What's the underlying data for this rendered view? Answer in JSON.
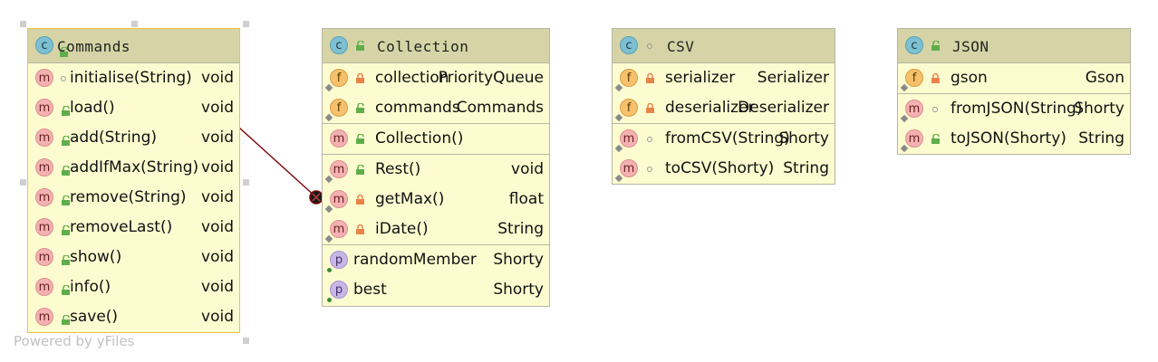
{
  "classes": {
    "commands": {
      "name": "Commands",
      "methods": [
        {
          "name": "initialise(String)",
          "type": "void",
          "visibility": "package"
        },
        {
          "name": "load()",
          "type": "void",
          "visibility": "public"
        },
        {
          "name": "add(String)",
          "type": "void",
          "visibility": "public"
        },
        {
          "name": "addIfMax(String)",
          "type": "void",
          "visibility": "public"
        },
        {
          "name": "remove(String)",
          "type": "void",
          "visibility": "public"
        },
        {
          "name": "removeLast()",
          "type": "void",
          "visibility": "public"
        },
        {
          "name": "show()",
          "type": "void",
          "visibility": "public"
        },
        {
          "name": "info()",
          "type": "void",
          "visibility": "public"
        },
        {
          "name": "save()",
          "type": "void",
          "visibility": "public"
        }
      ]
    },
    "collection": {
      "name": "Collection",
      "fields": [
        {
          "name": "collection",
          "type": "PriorityQueue",
          "visibility": "private"
        },
        {
          "name": "commands",
          "type": "Commands",
          "visibility": "public"
        }
      ],
      "constructors": [
        {
          "name": "Collection()",
          "type": "",
          "visibility": "public"
        }
      ],
      "methods": [
        {
          "name": "Rest()",
          "type": "void",
          "visibility": "public"
        },
        {
          "name": "getMax()",
          "type": "float",
          "visibility": "private"
        },
        {
          "name": "iDate()",
          "type": "String",
          "visibility": "private"
        }
      ],
      "properties": [
        {
          "name": "randomMember",
          "type": "Shorty"
        },
        {
          "name": "best",
          "type": "Shorty"
        }
      ]
    },
    "csv": {
      "name": "CSV",
      "fields": [
        {
          "name": "serializer",
          "type": "Serializer",
          "visibility": "private"
        },
        {
          "name": "deserializer",
          "type": "Deserializer",
          "visibility": "private"
        }
      ],
      "methods": [
        {
          "name": "fromCSV(String)",
          "type": "Shorty",
          "visibility": "package"
        },
        {
          "name": "toCSV(Shorty)",
          "type": "String",
          "visibility": "package"
        }
      ]
    },
    "json": {
      "name": "JSON",
      "fields": [
        {
          "name": "gson",
          "type": "Gson",
          "visibility": "private"
        }
      ],
      "methods": [
        {
          "name": "fromJSON(String)",
          "type": "Shorty",
          "visibility": "package"
        },
        {
          "name": "toJSON(Shorty)",
          "type": "String",
          "visibility": "public"
        }
      ]
    }
  },
  "badges": {
    "class": "c",
    "method": "m",
    "field": "f",
    "property": "p"
  },
  "watermark": "Powered by yFiles",
  "colors": {
    "header": "#d6d4a6",
    "body": "#fdfcd0",
    "selection": "#f0c23c",
    "edge": "#7a0a0a"
  }
}
